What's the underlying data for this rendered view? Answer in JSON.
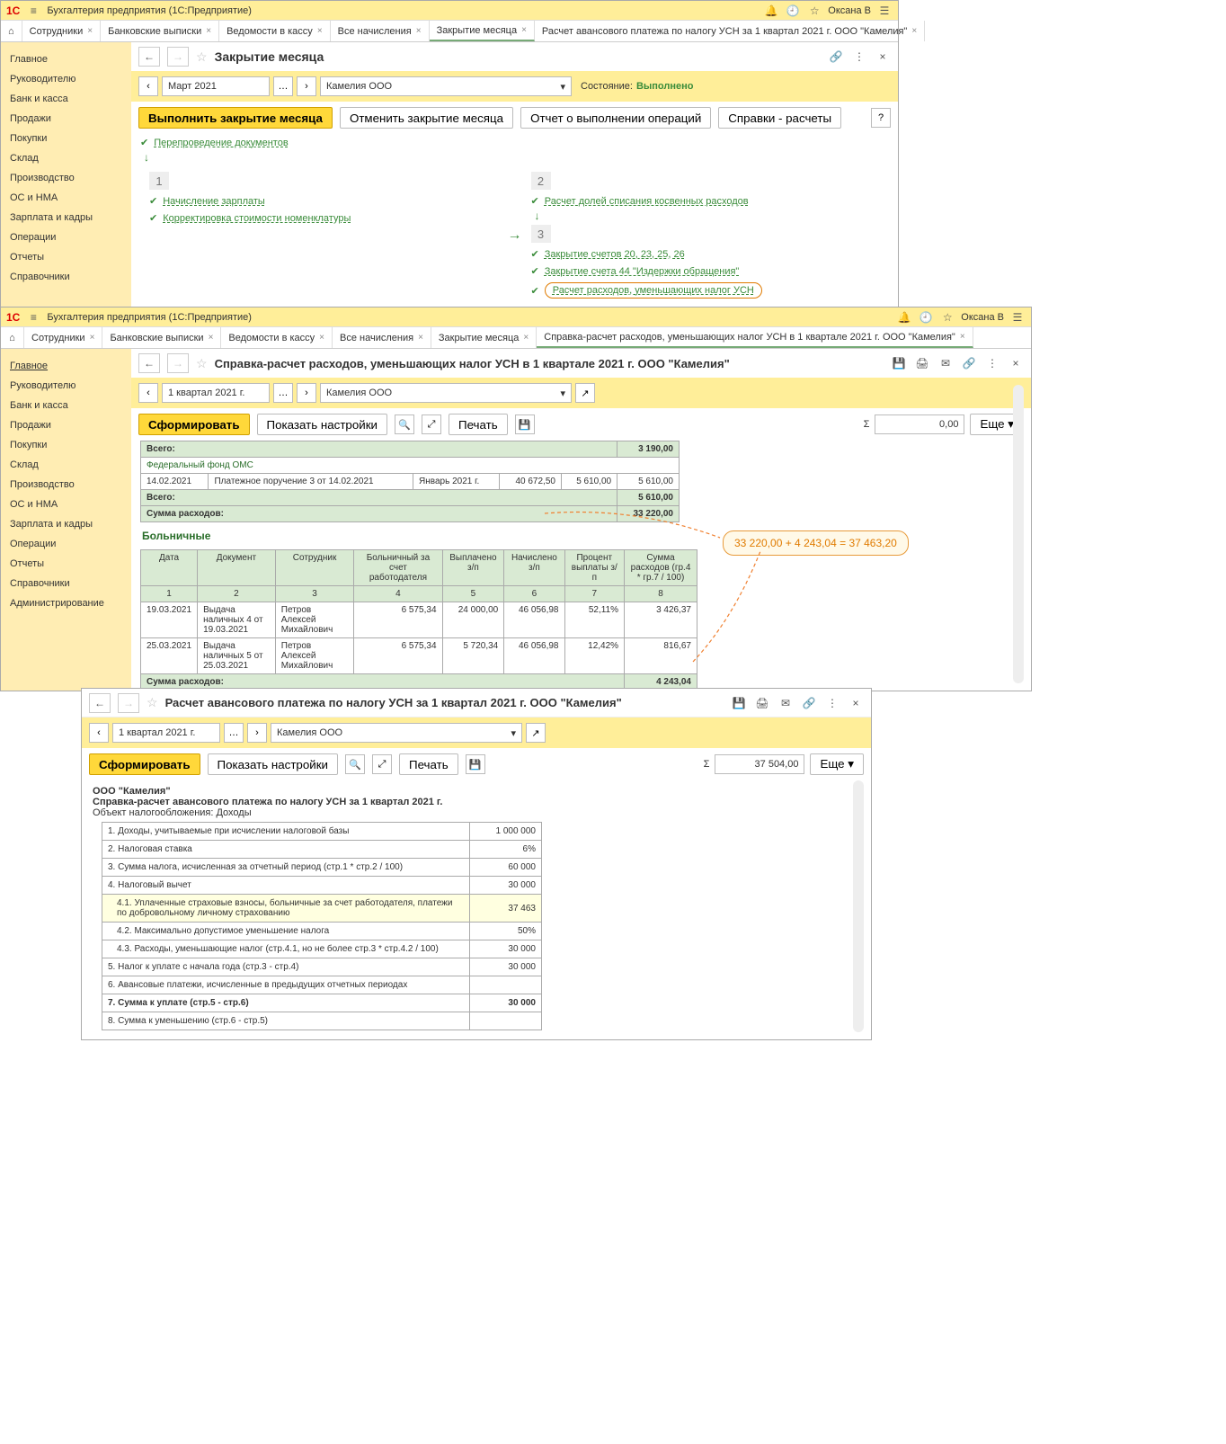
{
  "app_title": "Бухгалтерия предприятия  (1С:Предприятие)",
  "user": "Оксана В",
  "win1": {
    "tabs": [
      "Сотрудники",
      "Банковские выписки",
      "Ведомости в кассу",
      "Все начисления",
      "Закрытие месяца",
      "Расчет авансового платежа по налогу УСН за 1 квартал 2021 г. ООО \"Камелия\""
    ],
    "active_tab": 4,
    "sidebar": [
      "Главное",
      "Руководителю",
      "Банк и касса",
      "Продажи",
      "Покупки",
      "Склад",
      "Производство",
      "ОС и НМА",
      "Зарплата и кадры",
      "Операции",
      "Отчеты",
      "Справочники"
    ],
    "title": "Закрытие месяца",
    "period": "Март 2021",
    "org": "Камелия ООО",
    "state_label": "Состояние:",
    "state_val": "Выполнено",
    "buttons": {
      "run": "Выполнить закрытие месяца",
      "cancel": "Отменить закрытие месяца",
      "report": "Отчет о выполнении операций",
      "refs": "Справки - расчеты"
    },
    "pre": "Перепроведение документов",
    "s1": [
      "Начисление зарплаты",
      "Корректировка стоимости номенклатуры"
    ],
    "s2": [
      "Расчет долей списания косвенных расходов"
    ],
    "s3": [
      "Закрытие счетов 20, 23, 25, 26",
      "Закрытие счета 44 \"Издержки обращения\"",
      "Расчет расходов, уменьшающих налог УСН"
    ]
  },
  "win2": {
    "tabs": [
      "Сотрудники",
      "Банковские выписки",
      "Ведомости в кассу",
      "Все начисления",
      "Закрытие месяца",
      "Справка-расчет расходов, уменьшающих налог УСН в 1 квартале 2021 г. ООО \"Камелия\""
    ],
    "active_tab": 5,
    "sidebar": [
      "Главное",
      "Руководителю",
      "Банк и касса",
      "Продажи",
      "Покупки",
      "Склад",
      "Производство",
      "ОС и НМА",
      "Зарплата и кадры",
      "Операции",
      "Отчеты",
      "Справочники",
      "Администрирование"
    ],
    "title": "Справка-расчет расходов, уменьшающих налог УСН в 1 квартале 2021 г. ООО \"Камелия\"",
    "period": "1 квартал 2021 г.",
    "org": "Камелия ООО",
    "buttons": {
      "form": "Сформировать",
      "show": "Показать настройки",
      "print": "Печать",
      "more": "Еще"
    },
    "sum_field": "0,00",
    "top_rows": {
      "total1_lbl": "Всего:",
      "total1": "3 190,00",
      "fund": "Федеральный фонд ОМС",
      "r1": [
        "14.02.2021",
        "Платежное поручение 3 от 14.02.2021",
        "Январь 2021 г.",
        "40 672,50",
        "5 610,00",
        "5 610,00"
      ],
      "total2_lbl": "Всего:",
      "total2": "5 610,00",
      "sum_lbl": "Сумма расходов:",
      "sum": "33 220,00"
    },
    "sick_title": "Больничные",
    "sick_head": [
      "Дата",
      "Документ",
      "Сотрудник",
      "Больничный за счет работодателя",
      "Выплачено з/п",
      "Начислено з/п",
      "Процент выплаты з/п",
      "Сумма расходов (гр.4 * гр.7 / 100)"
    ],
    "sick_cols": [
      "1",
      "2",
      "3",
      "4",
      "5",
      "6",
      "7",
      "8"
    ],
    "sick_rows": [
      [
        "19.03.2021",
        "Выдача наличных 4 от 19.03.2021",
        "Петров Алексей Михайлович",
        "6 575,34",
        "24 000,00",
        "46 056,98",
        "52,11%",
        "3 426,37"
      ],
      [
        "25.03.2021",
        "Выдача наличных 5 от 25.03.2021",
        "Петров Алексей Михайлович",
        "6 575,34",
        "5 720,34",
        "46 056,98",
        "12,42%",
        "816,67"
      ]
    ],
    "sick_sum_lbl": "Сумма расходов:",
    "sick_sum": "4 243,04"
  },
  "annotation": "33 220,00 + 4 243,04 = 37 463,20",
  "win3": {
    "title": "Расчет авансового платежа по налогу УСН за 1 квартал 2021 г. ООО \"Камелия\"",
    "period": "1 квартал 2021 г.",
    "org": "Камелия ООО",
    "buttons": {
      "form": "Сформировать",
      "show": "Показать настройки",
      "print": "Печать",
      "more": "Еще"
    },
    "sum_field": "37 504,00",
    "head1": "ООО \"Камелия\"",
    "head2": "Справка-расчет авансового платежа по налогу УСН за 1 квартал 2021 г.",
    "head3": "Объект налогообложения:    Доходы",
    "rows": [
      {
        "l": "1. Доходы, учитываемые при исчислении налоговой базы",
        "v": "1 000 000"
      },
      {
        "l": "2. Налоговая ставка",
        "v": "6%"
      },
      {
        "l": "3. Сумма налога, исчисленная за отчетный период (стр.1 * стр.2 / 100)",
        "v": "60 000"
      },
      {
        "l": "4. Налоговый вычет",
        "v": "30 000"
      },
      {
        "l": "4.1. Уплаченные страховые взносы, больничные за счет работодателя, платежи по добровольному личному страхованию",
        "v": "37 463",
        "hl": true,
        "sub": true
      },
      {
        "l": "4.2. Максимально допустимое уменьшение налога",
        "v": "50%",
        "sub": true
      },
      {
        "l": "4.3. Расходы, уменьшающие налог (стр.4.1, но не более стр.3 * стр.4.2 / 100)",
        "v": "30 000",
        "sub": true
      },
      {
        "l": "5. Налог к уплате с начала года (стр.3 - стр.4)",
        "v": "30 000"
      },
      {
        "l": "6. Авансовые платежи, исчисленные в предыдущих отчетных периодах",
        "v": ""
      },
      {
        "l": "7. Сумма к уплате (стр.5 - стр.6)",
        "v": "30 000",
        "bold": true
      },
      {
        "l": "8. Сумма к уменьшению (стр.6 - стр.5)",
        "v": ""
      }
    ]
  }
}
